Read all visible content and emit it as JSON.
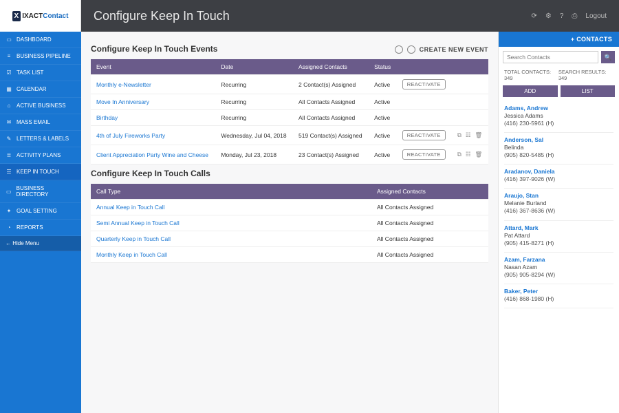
{
  "brand": {
    "mark": "X",
    "name1": "IXACT",
    "name2": "Contact"
  },
  "header": {
    "title": "Configure Keep In Touch",
    "logout": "Logout"
  },
  "sidebar": {
    "items": [
      {
        "icon": "▭",
        "label": "DASHBOARD"
      },
      {
        "icon": "≡",
        "label": "BUSINESS PIPELINE"
      },
      {
        "icon": "☑",
        "label": "TASK LIST"
      },
      {
        "icon": "▦",
        "label": "CALENDAR"
      },
      {
        "icon": "⌂",
        "label": "ACTIVE BUSINESS"
      },
      {
        "icon": "✉",
        "label": "MASS EMAIL"
      },
      {
        "icon": "✎",
        "label": "LETTERS & LABELS"
      },
      {
        "icon": "≣",
        "label": "ACTIVITY PLANS"
      },
      {
        "icon": "☰",
        "label": "KEEP IN TOUCH"
      },
      {
        "icon": "▭",
        "label": "BUSINESS DIRECTORY"
      },
      {
        "icon": "✦",
        "label": "GOAL SETTING"
      },
      {
        "icon": "◔",
        "label": "REPORTS"
      }
    ],
    "hide": "← Hide Menu"
  },
  "events": {
    "heading": "Configure Keep In Touch Events",
    "create": "CREATE NEW EVENT",
    "cols": {
      "event": "Event",
      "date": "Date",
      "assigned": "Assigned Contacts",
      "status": "Status"
    },
    "rows": [
      {
        "event": "Monthly e-Newsletter",
        "freq": "Recurring",
        "assigned": "2 Contact(s) Assigned",
        "status": "Active",
        "action": "REACTIVATE",
        "icons": false
      },
      {
        "event": "Move In Anniversary",
        "freq": "Recurring",
        "assigned": "All Contacts Assigned",
        "status": "Active",
        "action": "",
        "icons": false
      },
      {
        "event": "Birthday",
        "freq": "Recurring",
        "assigned": "All Contacts Assigned",
        "status": "Active",
        "action": "",
        "icons": false
      },
      {
        "event": "4th of July Fireworks Party",
        "freq": "Wednesday, Jul 04, 2018",
        "assigned": "519 Contact(s) Assigned",
        "status": "Active",
        "action": "REACTIVATE",
        "icons": true
      },
      {
        "event": "Client Appreciation Party Wine and Cheese",
        "freq": "Monday, Jul 23, 2018",
        "assigned": "23 Contact(s) Assigned",
        "status": "Active",
        "action": "REACTIVATE",
        "icons": true
      }
    ]
  },
  "calls": {
    "heading": "Configure Keep In Touch Calls",
    "cols": {
      "type": "Call Type",
      "assigned": "Assigned Contacts"
    },
    "rows": [
      {
        "type": "Annual Keep in Touch Call",
        "assigned": "All Contacts Assigned"
      },
      {
        "type": "Semi Annual Keep in Touch Call",
        "assigned": "All Contacts Assigned"
      },
      {
        "type": "Quarterly Keep in Touch Call",
        "assigned": "All Contacts Assigned"
      },
      {
        "type": "Monthly Keep in Touch Call",
        "assigned": "All Contacts Assigned"
      }
    ]
  },
  "right": {
    "contacts_btn": "+ CONTACTS",
    "search_ph": "Search Contacts",
    "total": "TOTAL CONTACTS: 349",
    "results": "SEARCH RESULTS: 349",
    "add": "ADD",
    "list": "LIST",
    "contacts": [
      {
        "name": "Adams, Andrew",
        "sub": "Jessica Adams",
        "phone": "(416) 230-5961 (H)"
      },
      {
        "name": "Anderson, Sal",
        "sub": "Belinda",
        "phone": "(905) 820-5485 (H)"
      },
      {
        "name": "Aradanov, Daniela",
        "sub": "",
        "phone": "(416) 397-9026 (W)"
      },
      {
        "name": "Araujo, Stan",
        "sub": "Melanie Burland",
        "phone": "(416) 367-8636 (W)"
      },
      {
        "name": "Attard, Mark",
        "sub": "Pat Attard",
        "phone": "(905) 415-8271 (H)"
      },
      {
        "name": "Azam, Farzana",
        "sub": "Nasan Azam",
        "phone": "(905) 905-8294 (W)"
      },
      {
        "name": "Baker, Peter",
        "sub": "",
        "phone": "(416) 868-1980 (H)"
      }
    ]
  }
}
